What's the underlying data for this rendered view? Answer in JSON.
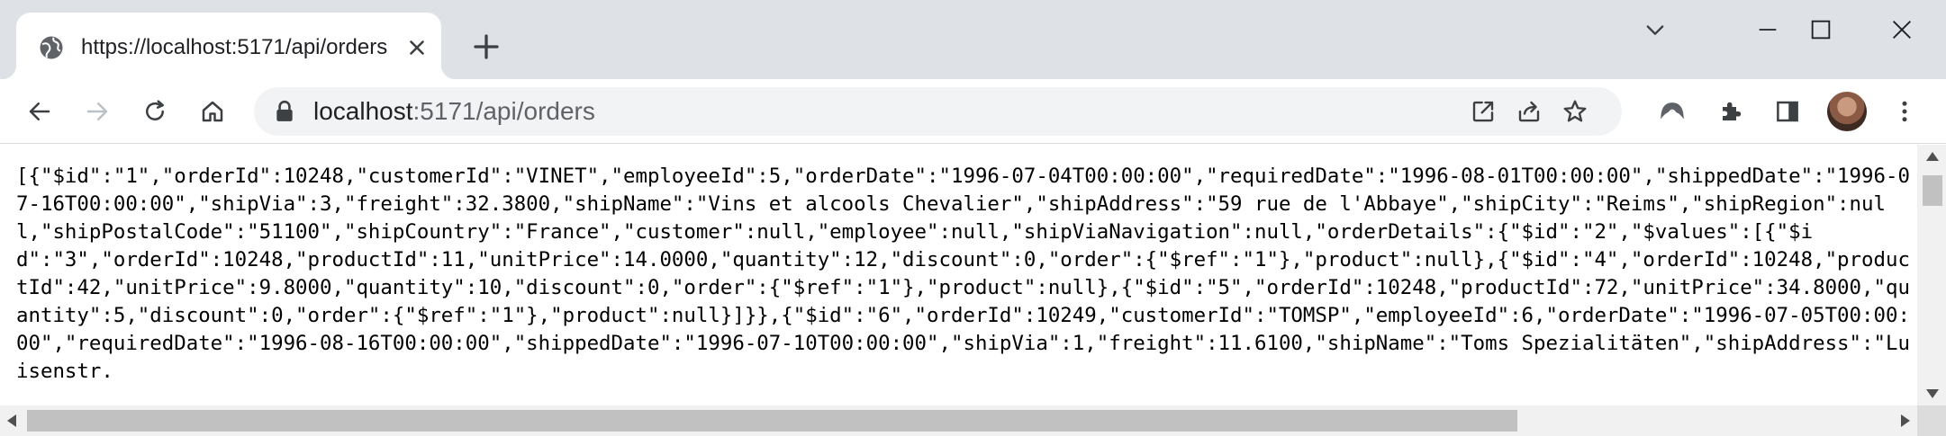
{
  "colors": {
    "tab_strip": "#dee1e6",
    "omnibox": "#f1f3f4",
    "icon": "#5f6368",
    "text": "#202124"
  },
  "tab": {
    "title": "https://localhost:5171/api/orders",
    "favicon": "globe-icon"
  },
  "omnibox": {
    "url_host": "localhost",
    "url_rest": ":5171/api/orders"
  },
  "toolbar_icons": [
    "back-icon",
    "forward-icon",
    "reload-icon",
    "home-icon",
    "lock-icon",
    "open-in-app-icon",
    "share-icon",
    "star-icon",
    "profile-logo-icon",
    "puzzle-icon",
    "side-panel-icon",
    "avatar",
    "kebab-menu-icon"
  ],
  "content": {
    "json_text": "[{\"$id\":\"1\",\"orderId\":10248,\"customerId\":\"VINET\",\"employeeId\":5,\"orderDate\":\"1996-07-04T00:00:00\",\"requiredDate\":\"1996-08-01T00:00:00\",\"shippedDate\":\"1996-07-16T00:00:00\",\"shipVia\":3,\"freight\":32.3800,\"shipName\":\"Vins et alcools Chevalier\",\"shipAddress\":\"59 rue de l'Abbaye\",\"shipCity\":\"Reims\",\"shipRegion\":null,\"shipPostalCode\":\"51100\",\"shipCountry\":\"France\",\"customer\":null,\"employee\":null,\"shipViaNavigation\":null,\"orderDetails\":{\"$id\":\"2\",\"$values\":[{\"$id\":\"3\",\"orderId\":10248,\"productId\":11,\"unitPrice\":14.0000,\"quantity\":12,\"discount\":0,\"order\":{\"$ref\":\"1\"},\"product\":null},{\"$id\":\"4\",\"orderId\":10248,\"productId\":42,\"unitPrice\":9.8000,\"quantity\":10,\"discount\":0,\"order\":{\"$ref\":\"1\"},\"product\":null},{\"$id\":\"5\",\"orderId\":10248,\"productId\":72,\"unitPrice\":34.8000,\"quantity\":5,\"discount\":0,\"order\":{\"$ref\":\"1\"},\"product\":null}]}},{\"$id\":\"6\",\"orderId\":10249,\"customerId\":\"TOMSP\",\"employeeId\":6,\"orderDate\":\"1996-07-05T00:00:00\",\"requiredDate\":\"1996-08-16T00:00:00\",\"shippedDate\":\"1996-07-10T00:00:00\",\"shipVia\":1,\"freight\":11.6100,\"shipName\":\"Toms Spezialitäten\",\"shipAddress\":\"Luisenstr."
  }
}
